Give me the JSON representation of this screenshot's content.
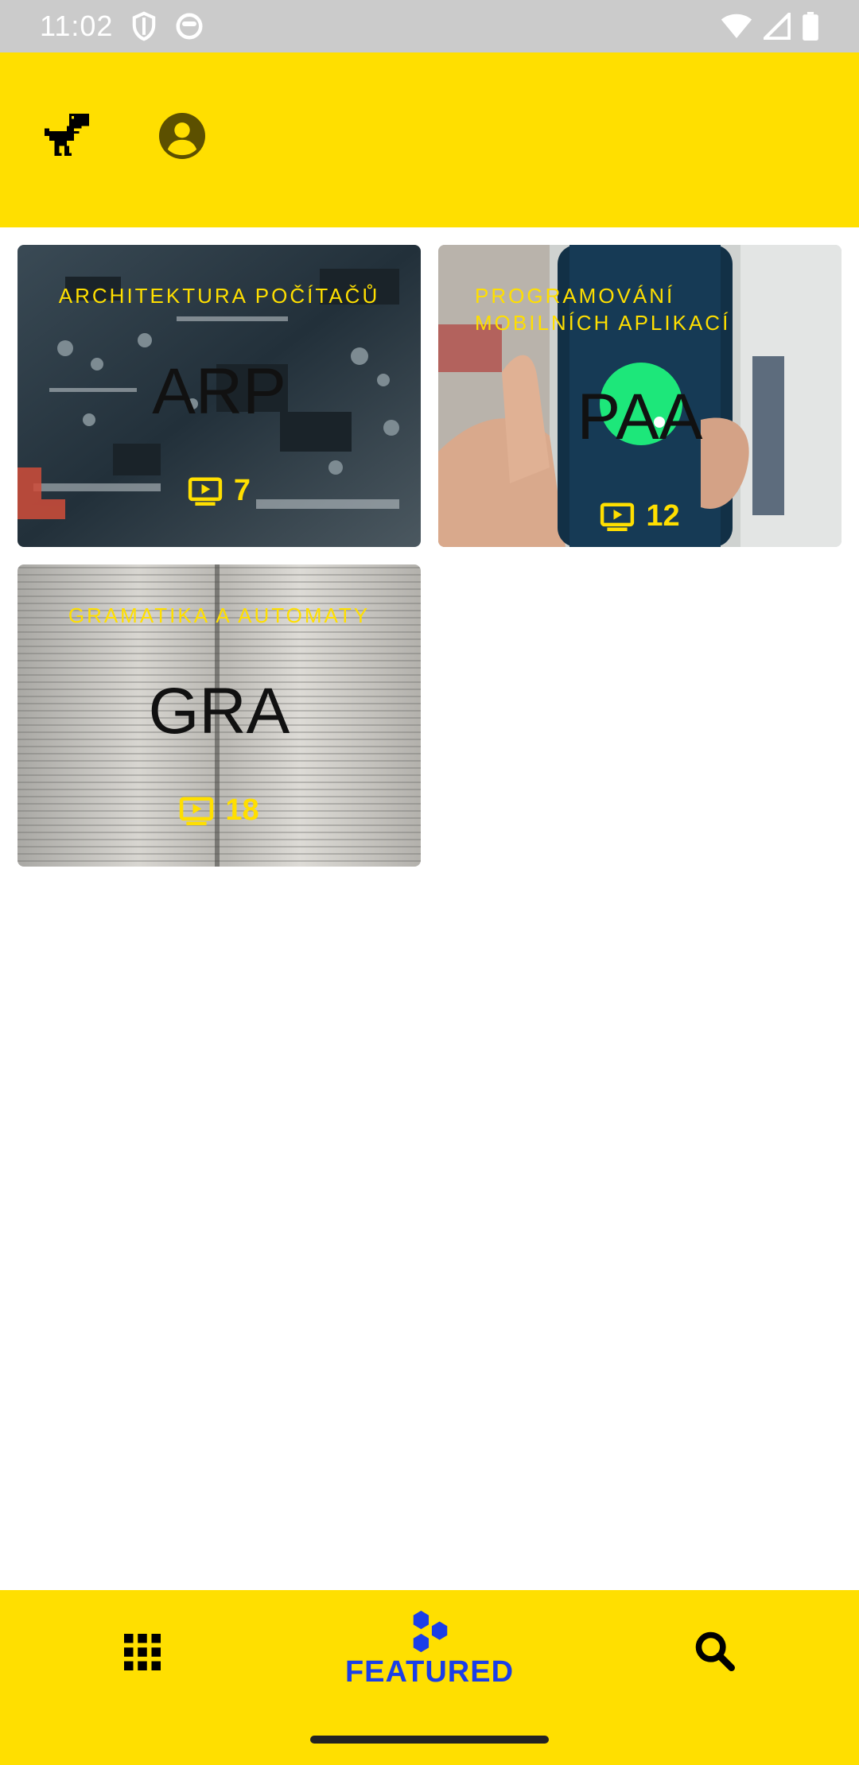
{
  "status_bar": {
    "time": "11:02",
    "icons": [
      "shield-icon",
      "face-icon",
      "wifi-icon",
      "signal-icon",
      "battery-icon"
    ]
  },
  "app_bar": {
    "icons": [
      "dino-logo-icon",
      "account-circle-icon"
    ]
  },
  "courses": [
    {
      "category": "ARCHITEKTURA POČÍTAČŮ",
      "code": "ARP",
      "count": "7"
    },
    {
      "category_line1": "PROGRAMOVÁNÍ",
      "category_line2": "MOBILNÍCH APLIKACÍ",
      "code": "PAA",
      "count": "12"
    },
    {
      "category": "GRAMATIKA A AUTOMATY",
      "code": "GRA",
      "count": "18"
    }
  ],
  "bottom_nav": {
    "featured_label": "FEATURED",
    "icons": [
      "grid-icon",
      "hexagons-icon",
      "search-icon"
    ]
  },
  "colors": {
    "accent": "#ffdf00",
    "nav_active": "#1a3ee8",
    "status_bar": "#cbcbcb"
  }
}
